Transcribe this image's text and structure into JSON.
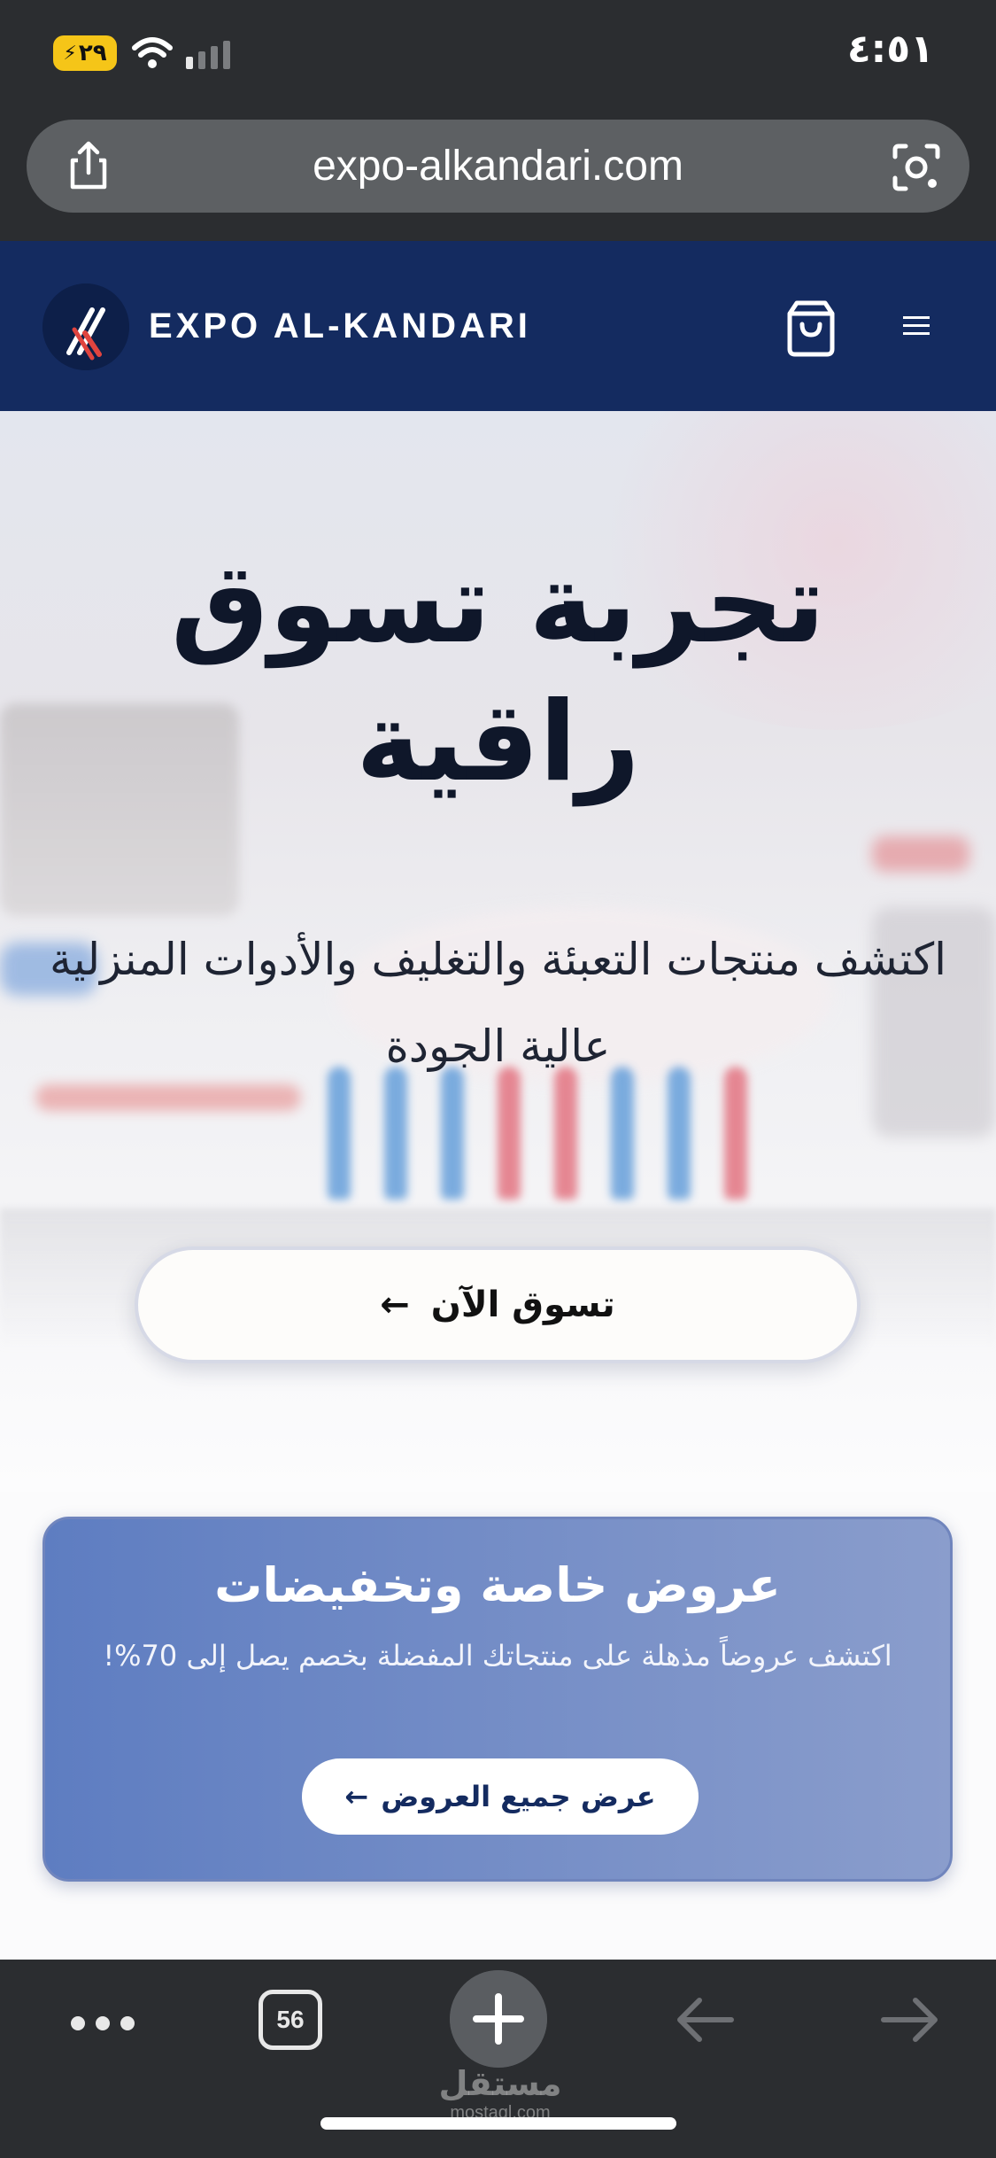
{
  "status_bar": {
    "time": "٤:٥١",
    "battery": "٢٩"
  },
  "browser": {
    "url": "expo-alkandari.com"
  },
  "site": {
    "brand": "EXPO AL-KANDARI"
  },
  "hero": {
    "title": "تجربة تسوق راقية",
    "subtitle": "اكتشف منتجات التعبئة والتغليف والأدوات المنزلية عالية الجودة",
    "cta_label": "تسوق الآن",
    "cta_arrow": "←"
  },
  "offers": {
    "title": "عروض خاصة وتخفيضات",
    "text": "اكتشف عروضاً مذهلة على منتجاتك المفضلة بخصم يصل إلى 70%!",
    "button_label": "عرض جميع العروض",
    "button_arrow": "←"
  },
  "toolbar": {
    "tab_count": "56"
  },
  "watermark": {
    "arabic": "مستقل",
    "latin": "mostaql.com"
  },
  "colors": {
    "header_bg": "#142b60",
    "chrome_bg": "#2b2d30",
    "offers_gradient_start": "#5e7dc1",
    "offers_gradient_end": "#8a9dcc",
    "title_text": "#0f172a"
  }
}
